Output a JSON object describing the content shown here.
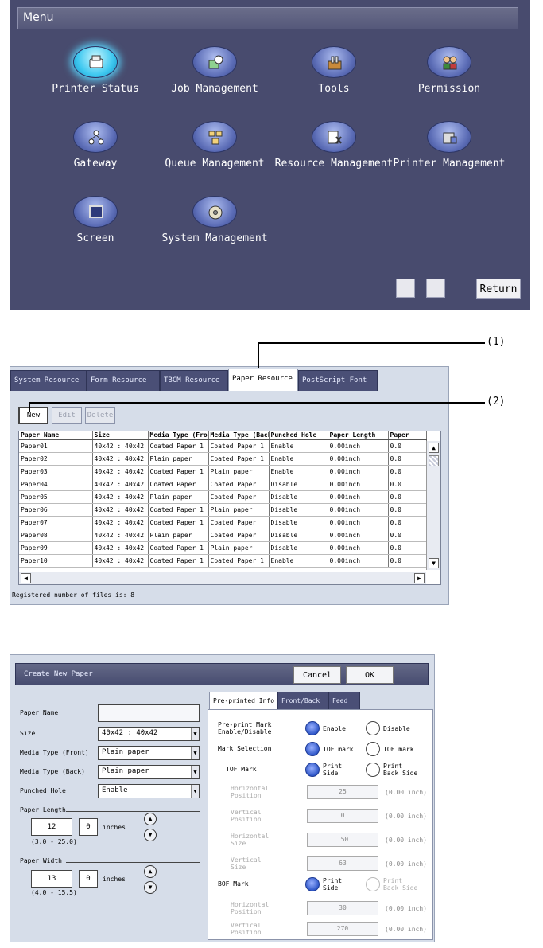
{
  "menu": {
    "title": "Menu",
    "items": [
      {
        "label": "Printer Status",
        "icon": "printer-icon"
      },
      {
        "label": "Job Management",
        "icon": "job-icon"
      },
      {
        "label": "Tools",
        "icon": "tools-icon"
      },
      {
        "label": "Permission",
        "icon": "users-icon"
      },
      {
        "label": "Gateway",
        "icon": "network-icon"
      },
      {
        "label": "Queue Management",
        "icon": "queue-icon"
      },
      {
        "label": "Resource Management",
        "icon": "resource-icon"
      },
      {
        "label": "Printer Management",
        "icon": "printer-manage-icon"
      },
      {
        "label": "Screen",
        "icon": "screen-icon"
      },
      {
        "label": "System Management",
        "icon": "disc-icon"
      }
    ],
    "return_label": "Return"
  },
  "paper": {
    "tabs": [
      "System Resource",
      "Form Resource",
      "TBCM Resource",
      "Paper Resource",
      "PostScript Font"
    ],
    "buttons": {
      "new": "New",
      "edit": "Edit",
      "delete": "Delete"
    },
    "columns": [
      "Paper Name",
      "Size",
      "Media Type (Front)",
      "Media Type (Back)",
      "Punched Hole",
      "Paper Length",
      "Paper"
    ],
    "rows": [
      [
        "Paper01",
        "40x42 : 40x42",
        "Coated Paper 1",
        "Coated Paper 1",
        "Enable",
        "0.00inch",
        "0.0"
      ],
      [
        "Paper02",
        "40x42 : 40x42",
        "Plain paper",
        "Coated Paper 1",
        "Enable",
        "0.00inch",
        "0.0"
      ],
      [
        "Paper03",
        "40x42 : 40x42",
        "Coated Paper 1",
        "Plain paper",
        "Enable",
        "0.00inch",
        "0.0"
      ],
      [
        "Paper04",
        "40x42 : 40x42",
        "Coated Paper",
        "Coated Paper",
        "Disable",
        "0.00inch",
        "0.0"
      ],
      [
        "Paper05",
        "40x42 : 40x42",
        "Plain paper",
        "Coated Paper",
        "Disable",
        "0.00inch",
        "0.0"
      ],
      [
        "Paper06",
        "40x42 : 40x42",
        "Coated Paper 1",
        "Plain paper",
        "Disable",
        "0.00inch",
        "0.0"
      ],
      [
        "Paper07",
        "40x42 : 40x42",
        "Coated Paper 1",
        "Coated Paper",
        "Disable",
        "0.00inch",
        "0.0"
      ],
      [
        "Paper08",
        "40x42 : 40x42",
        "Plain paper",
        "Coated Paper",
        "Disable",
        "0.00inch",
        "0.0"
      ],
      [
        "Paper09",
        "40x42 : 40x42",
        "Coated Paper 1",
        "Plain paper",
        "Disable",
        "0.00inch",
        "0.0"
      ],
      [
        "Paper10",
        "40x42 : 40x42",
        "Coated Paper 1",
        "Coated Paper 1",
        "Enable",
        "0.00inch",
        "0.0"
      ]
    ],
    "records_text": "Registered number of files is: 8",
    "callout_1": "(1)",
    "callout_2": "(2)"
  },
  "create": {
    "title": "Create New Paper",
    "cancel_label": "Cancel",
    "ok_label": "OK",
    "fields": {
      "paper_name_label": "Paper Name",
      "paper_name_value": "",
      "size_label": "Size",
      "size_value": "40x42 : 40x42",
      "media_front_label": "Media Type (Front)",
      "media_front_value": "Plain paper",
      "media_back_label": "Media Type (Back)",
      "media_back_value": "Plain paper",
      "punched_label": "Punched Hole",
      "punched_value": "Enable",
      "paper_length_label": "Paper Length",
      "paper_length_int": "12",
      "paper_length_dec": "0",
      "paper_length_unit": "inches",
      "paper_length_range": "(3.0 - 25.0)",
      "paper_width_label": "Paper Width",
      "paper_width_int": "13",
      "paper_width_dec": "0",
      "paper_width_unit": "inches",
      "paper_width_range": "(4.0 - 15.5)"
    },
    "tabs": [
      "Pre-printed Info",
      "Front/Back",
      "Feed"
    ],
    "right": {
      "rows": [
        {
          "label": "Pre-print Mark\nEnable/Disable",
          "opt1": "Enable",
          "opt2": "Disable"
        },
        {
          "label": "Mark Selection",
          "opt1": "TOF mark",
          "opt2": "TOF mark"
        },
        {
          "label": "TOF Mark",
          "opt1": "Print\nSide",
          "opt2": "Print\nBack Side"
        }
      ],
      "numeric": [
        {
          "label": "Horizontal\nPosition",
          "value": "25",
          "unit": "(0.00 inch)"
        },
        {
          "label": "Vertical\nPosition",
          "value": "0",
          "unit": "(0.00 inch)"
        },
        {
          "label": "Horizontal\nSize",
          "value": "150",
          "unit": "(0.00 inch)"
        },
        {
          "label": "Vertical\nSize",
          "value": "63",
          "unit": "(0.00 inch)"
        }
      ],
      "bof": {
        "label": "BOF Mark",
        "opt1": "Print\nSide",
        "opt2": "Print\nBack Side"
      },
      "numeric2": [
        {
          "label": "Horizontal\nPosition",
          "value": "30",
          "unit": "(0.00 inch)"
        },
        {
          "label": "Vertical\nPosition",
          "value": "270",
          "unit": "(0.00 inch)"
        }
      ]
    }
  },
  "colors": {
    "menu_bg": "#484b6e",
    "tab_bg": "#4a4f76",
    "panel_bg": "#d6dde9",
    "radio_on": "#2f57c8",
    "active_icon": "#3ec8f0"
  }
}
